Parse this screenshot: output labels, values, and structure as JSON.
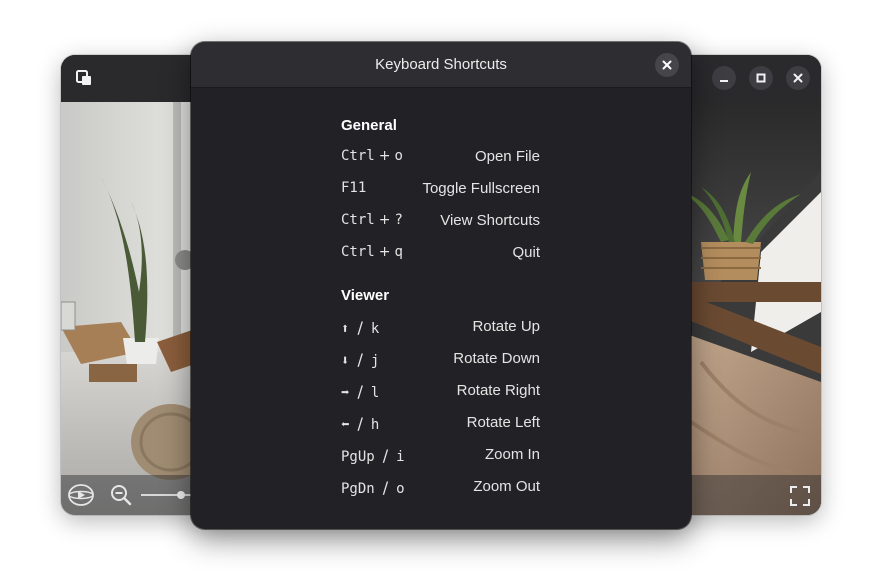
{
  "dialog": {
    "title": "Keyboard Shortcuts",
    "sections": [
      {
        "title": "General",
        "rows": [
          {
            "key1": "Ctrl",
            "sep": "+",
            "key2": "o",
            "action": "Open File"
          },
          {
            "key1": "F11",
            "sep": "",
            "key2": "",
            "action": "Toggle Fullscreen"
          },
          {
            "key1": "Ctrl",
            "sep": "+",
            "key2": "?",
            "action": "View Shortcuts"
          },
          {
            "key1": "Ctrl",
            "sep": "+",
            "key2": "q",
            "action": "Quit"
          }
        ]
      },
      {
        "title": "Viewer",
        "rows": [
          {
            "key1": "⬆",
            "sep": "/",
            "key2": "k",
            "action": "Rotate Up"
          },
          {
            "key1": "⬇",
            "sep": "/",
            "key2": "j",
            "action": "Rotate Down"
          },
          {
            "key1": "➡",
            "sep": "/",
            "key2": "l",
            "action": "Rotate Right"
          },
          {
            "key1": "⬅",
            "sep": "/",
            "key2": "h",
            "action": "Rotate Left"
          },
          {
            "key1": "PgUp",
            "sep": "/",
            "key2": "i",
            "action": "Zoom In"
          },
          {
            "key1": "PgDn",
            "sep": "/",
            "key2": "o",
            "action": "Zoom Out"
          }
        ]
      }
    ]
  },
  "viewer": {
    "header_buttons": [
      "app-icon",
      "minimize-icon",
      "maximize-icon",
      "close-icon"
    ],
    "toolbar_icons": [
      "360-view-icon",
      "zoom-out-icon",
      "fullscreen-icon"
    ]
  },
  "colors": {
    "dialog_bg": "#222226",
    "dialog_header": "#2e2e32",
    "text": "#e4e4e4"
  }
}
